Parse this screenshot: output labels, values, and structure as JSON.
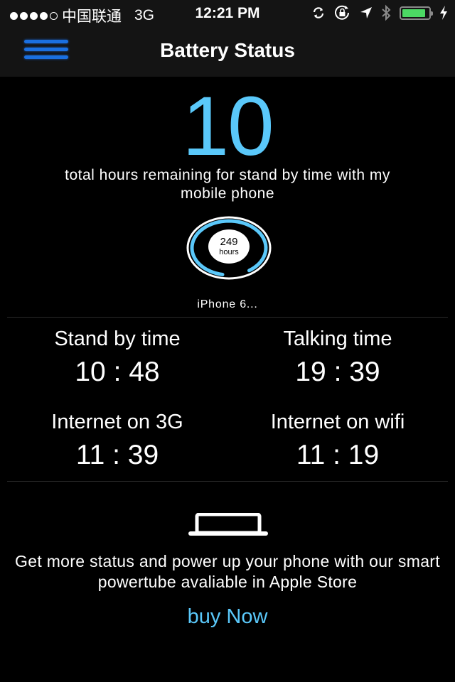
{
  "status_bar": {
    "signal_bars_filled": 4,
    "signal_bars_total": 5,
    "carrier": "中国联通",
    "network": "3G",
    "time": "12:21 PM",
    "icons": [
      "sync-icon",
      "rotation-lock-icon",
      "location-arrow-icon",
      "bluetooth-icon",
      "battery-icon",
      "charging-bolt-icon"
    ],
    "battery_level": 0.9,
    "battery_color": "#4cd964"
  },
  "nav": {
    "menu_icon": "hamburger-menu-icon",
    "title": "Battery Status",
    "menu_color": "#1a6fe0"
  },
  "summary": {
    "hours_remaining": "10",
    "description": "total hours remaining for stand by time with my mobile phone",
    "accent_color": "#5ac8fa"
  },
  "gauge": {
    "value": "249",
    "unit": "hours",
    "progress": 0.88
  },
  "device": {
    "name": "iPhone 6..."
  },
  "stats": [
    {
      "label": "Stand by time",
      "value": "10 : 48"
    },
    {
      "label": "Talking time",
      "value": "19 : 39"
    },
    {
      "label": "Internet on 3G",
      "value": "11 : 39"
    },
    {
      "label": "Internet on wifi",
      "value": "11 : 19"
    }
  ],
  "promo": {
    "icon": "laptop-icon",
    "text": "Get more status and power up your phone with our smart powertube avaliable in Apple Store",
    "button_label": "buy Now"
  }
}
